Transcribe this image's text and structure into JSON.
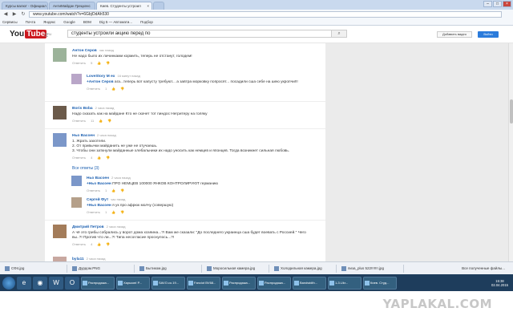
{
  "tabs": [
    {
      "label": "Курсы валют - Официал",
      "active": false
    },
    {
      "label": "АнтиМайдан Грецкенс",
      "active": false
    },
    {
      "label": "Киев. Студенты устроил",
      "active": true
    },
    {
      "label": "",
      "active": false
    }
  ],
  "address": {
    "url": "www.youtube.com/watch?v=6GbjOdAh530"
  },
  "bookmarks": [
    "Сервисы",
    "Почта",
    "Яндекс",
    "Google",
    "ВОМ",
    "Dig 5 — Автомати...",
    "Подбор"
  ],
  "header": {
    "logo_you": "You",
    "logo_tube": "Tube",
    "logo_region": "RU",
    "search_value": "студенты устроили акцию перед по",
    "upload_label": "Добавить видео",
    "login_label": "Войти"
  },
  "comments": [
    {
      "author": "Антон Серов",
      "time": "час назад",
      "text": "Не надо было их личинками кормить, теперь не отстанут, голодем!",
      "likes": "5"
    },
    {
      "author": "LoveStory M ex",
      "time": "16 минут назад",
      "mention": "+Антон Серов",
      "text": " ага...теперь вот капусту требуют... а завтра морковку попросят... посадили сша себе на шею укропчи!!!",
      "likes": "1"
    },
    {
      "author": "Boris Boba",
      "time": "2 часа назад",
      "text": "Надо сказать как на майдане Кто не скачет тот пиндос Негритеру на голяку",
      "likes": "11"
    },
    {
      "author": "Ньо Васоен",
      "time": "2 часа назад",
      "lines": [
        "1. Жрать захотели.",
        "2. От привычки майданить не уже не отучаешь.",
        "3. Чтобы они заткнули майданные хлебальники их надо уносить как немцев и японцев. Тогда возникнет сильная любовь."
      ],
      "likes": "4"
    },
    {
      "author": "Ньо Васоен",
      "time": "2 часа назад",
      "mention": "+Ньо Васоен",
      "text": " ПРО НЕМЦЕВ 100000 ЯНКОВ КОНТРОЛИРУЮТ германию",
      "likes": "1"
    },
    {
      "author": "Сергей Фут",
      "time": "час назад",
      "mention": "+Ньо Васоен",
      "text": " я ук про афрюк молчу (совершую)",
      "likes": "1"
    },
    {
      "author": "Дмитрий Петров",
      "time": "2 часа назад",
      "text": "А чё это грибы собрались у ворот дома хозяина...?! Вам же сказали: \"До последнего украинца сша будет воевать с Россией.\" Чего вы..?! Против что ли...?! Типа несогласие проснулось...?!",
      "likes": "4"
    },
    {
      "author": "byla11",
      "time": "2 часа назад",
      "text": "",
      "likes": ""
    }
  ],
  "actions": {
    "reply_label": "Ответить"
  },
  "replies_toggle": "Все ответы (3)",
  "downloads": [
    "СФ4.jpg",
    "Дурдом.PNG",
    "Бытиком.jpg",
    "Моросильная камера.jpg",
    "Холодильная камера.jpg",
    "пиза_plus 522!!!!!!!.jpg"
  ],
  "downloads_all": "Все полученные файлы...",
  "taskbar": {
    "tasks": [
      "Распродажа...",
      "Харьков! Р...",
      "SAVO.co.19...",
      "Fanciot BV68...",
      "Распродажа...",
      "Распродажа...",
      "Bandwidth...",
      "1-3.Ukr...",
      "Киев. Студ..."
    ],
    "time": "15:38",
    "date": "02.04.2015"
  },
  "watermark": "YAPLAKAL.COM"
}
